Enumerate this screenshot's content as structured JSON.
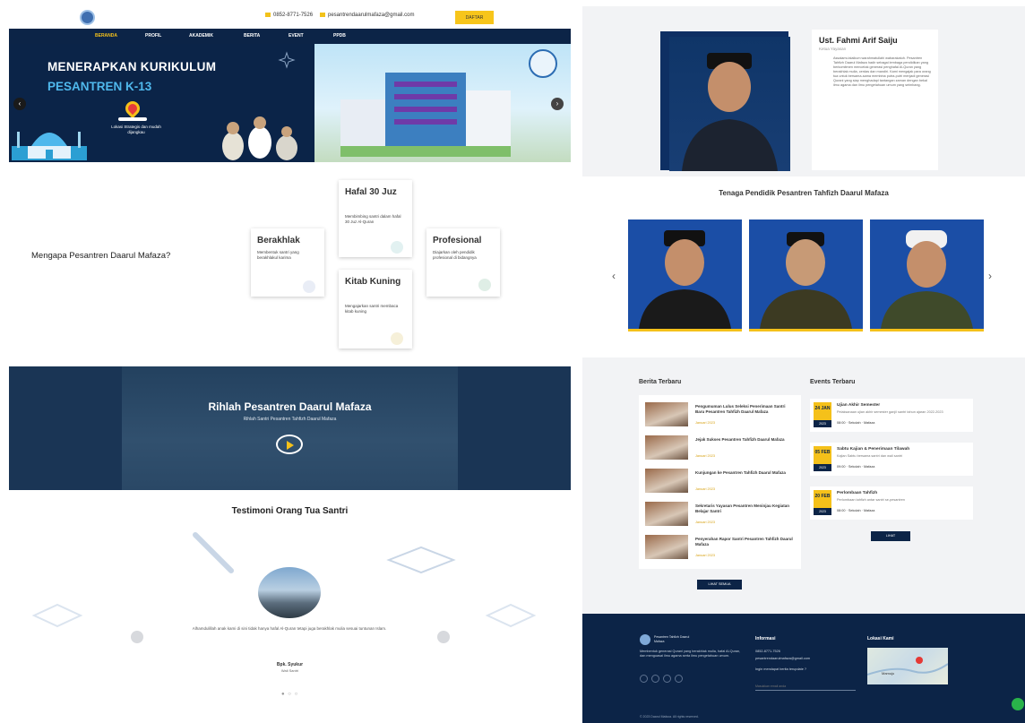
{
  "topbar": {
    "phone": "0852-8771-7526",
    "email": "pesantrendaarulmafaza@gmail.com",
    "cta": "DAFTAR"
  },
  "nav": [
    "BERANDA",
    "PROFIL",
    "AKADEMIK",
    "BERITA",
    "EVENT",
    "PPDB"
  ],
  "hero": {
    "title_line1": "MENERAPKAN KURIKULUM",
    "title_line2": "PESANTREN K-13",
    "caption": "Lokasi Strategis dan mudah dijangkau"
  },
  "why": {
    "title": "Mengapa Pesantren Daarul Mafaza?",
    "cards": [
      {
        "title": "Berakhlak",
        "desc": "Membentuk santri yang berakhlakul karima"
      },
      {
        "title": "Hafal 30 Juz",
        "desc": "Membimbing santri dalam hafal 30 Juz Al-Quran"
      },
      {
        "title": "Profesional",
        "desc": "Diajarkan oleh pendidik profesional di bidangnya"
      },
      {
        "title": "Kitab Kuning",
        "desc": "Mengajarkan santri membaca kitab kuning"
      }
    ]
  },
  "video": {
    "title": "Rihlah Pesantren Daarul Mafaza",
    "subtitle": "Rihlah Santri Pesantren Tahfizh Daarul Mafaza"
  },
  "testimoni": {
    "title": "Testimoni Orang Tua Santri",
    "quote": "Alhamdulillah anak kami di sini tidak hanya hafal Al-Quran tetapi juga berakhlak mulia sesuai tuntunan Islam.",
    "name": "Bpk. Syukur",
    "role": "Wali Santri",
    "dots": "● ○ ○"
  },
  "profile": {
    "name": "Ust. Fahmi Arif Saiju",
    "role": "Ketua Yayasan",
    "text": "Assalamu'alaikum warahmatullahi wabarakatuh. Pesantren Tahfizh Daarul Mafaza hadir sebagai lembaga pendidikan yang berkomitmen mencetak generasi penghafal Al-Quran yang berakhlak mulia, cerdas dan mandiri. Kami mengajak para orang tua untuk bersama-sama membina putra-putri menjadi generasi Qurani yang siap menghadapi tantangan zaman dengan bekal ilmu agama dan ilmu pengetahuan umum yang seimbang."
  },
  "staff": {
    "title": "Tenaga Pendidik Pesantren Tahfizh Daarul Mafaza",
    "prev": "‹",
    "next": "›"
  },
  "news": {
    "heading": "Berita Terbaru",
    "items": [
      {
        "title": "Pengumuman Lulus Seleksi Penerimaan Santri Baru Pesantren Tahfizh Daarul Mafaza",
        "date": "Januari 2023"
      },
      {
        "title": "Jejak Sukses Pesantren Tahfizh Daarul Mafaza",
        "date": "Januari 2023"
      },
      {
        "title": "Kunjungan ke Pesantren Tahfizh Daarul Mafaza",
        "date": "Januari 2023"
      },
      {
        "title": "Sekretaris Yayasan Pesantren Meninjau Kegiatan Belajar Santri",
        "date": "Januari 2023"
      },
      {
        "title": "Penyerahan Rapor Santri Pesantren Tahfizh Daarul Mafaza",
        "date": "Januari 2023"
      }
    ],
    "more": "LIHAT SEMUA"
  },
  "events": {
    "heading": "Events Terbaru",
    "items": [
      {
        "day": "24 JAN",
        "year": "2023",
        "title": "Ujian Akhir Semester",
        "desc": "Pelaksanaan ujian akhir semester ganjil santri tahun ajaran 2022-2023",
        "meta": "08:00 · Sekolah · Mafaza"
      },
      {
        "day": "05 FEB",
        "year": "2023",
        "title": "Sabtu Kajian & Penerimaan Tilawah",
        "desc": "Kajian Sabtu bersama santri dan wali santri",
        "meta": "09:00 · Sekolah · Mafaza"
      },
      {
        "day": "20 FEB",
        "year": "2023",
        "title": "Perlombaan Tahfizh",
        "desc": "Perlombaan tahfizh antar santri se-pesantren",
        "meta": "08:00 · Sekolah · Mafaza"
      }
    ],
    "more": "LIHAT"
  },
  "footer": {
    "brand": "Pesantren Tahfizh Daarul Mafaza",
    "desc": "Membentuk generasi Qurani yang berakhlak mulia, hafal Al-Quran, dan menguasai ilmu agama serta ilmu pengetahuan umum.",
    "info_heading": "Informasi",
    "phone": "0852-8771-7526",
    "email": "pesantrendaarulmafaza@gmail.com",
    "question": "Ingin mendapat berita terupdate ?",
    "subscribe_placeholder": "Masukkan email anda",
    "location_heading": "Lokasi Kami",
    "map_label": "Mamuju",
    "copyright": "© 2023 Daarul Mafaza. All rights reserved."
  },
  "colors": {
    "navy": "#0c2447",
    "accent": "#f5c11a",
    "light_blue": "#4fb8ec",
    "staff_blue": "#1b4ea6"
  }
}
